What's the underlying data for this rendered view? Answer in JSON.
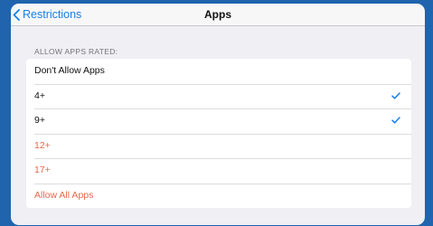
{
  "navbar": {
    "back_label": "Restrictions",
    "title": "Apps"
  },
  "section": {
    "header": "ALLOW APPS RATED:"
  },
  "rows": [
    {
      "label": "Don't Allow Apps",
      "checked": false,
      "color": "#111111"
    },
    {
      "label": "4+",
      "checked": true,
      "color": "#111111"
    },
    {
      "label": "9+",
      "checked": true,
      "color": "#111111"
    },
    {
      "label": "12+",
      "checked": false,
      "color": "#e8684b"
    },
    {
      "label": "17+",
      "checked": false,
      "color": "#e8684b"
    },
    {
      "label": "Allow All Apps",
      "checked": false,
      "color": "#e8684b"
    }
  ],
  "colors": {
    "accent": "#1a7fe6",
    "warning": "#e8684b",
    "frame": "#1f64ad"
  },
  "icons": {
    "back": "chevron-left-icon",
    "check": "checkmark-icon"
  }
}
